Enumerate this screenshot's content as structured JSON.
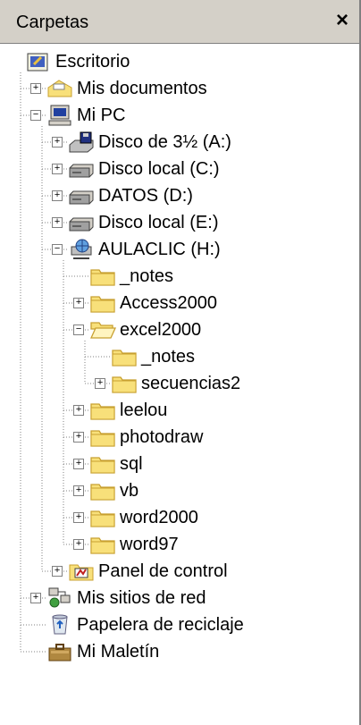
{
  "header": {
    "title": "Carpetas",
    "close_label": "×"
  },
  "tree": [
    {
      "label": "Escritorio",
      "icon": "desktop-icon",
      "level": 0,
      "expander": "none",
      "name": "tree-item-escritorio"
    },
    {
      "label": "Mis documentos",
      "icon": "my-documents-icon",
      "level": 1,
      "expander": "plus",
      "name": "tree-item-mis-documentos"
    },
    {
      "label": "Mi PC",
      "icon": "computer-icon",
      "level": 1,
      "expander": "minus",
      "name": "tree-item-mi-pc"
    },
    {
      "label": "Disco de 3½ (A:)",
      "icon": "floppy-drive-icon",
      "level": 2,
      "expander": "plus",
      "name": "tree-item-disco-a"
    },
    {
      "label": "Disco local (C:)",
      "icon": "hard-drive-icon",
      "level": 2,
      "expander": "plus",
      "name": "tree-item-disco-c"
    },
    {
      "label": "DATOS (D:)",
      "icon": "hard-drive-icon",
      "level": 2,
      "expander": "plus",
      "name": "tree-item-datos-d"
    },
    {
      "label": "Disco local (E:)",
      "icon": "hard-drive-icon",
      "level": 2,
      "expander": "plus",
      "name": "tree-item-disco-e"
    },
    {
      "label": "AULACLIC (H:)",
      "icon": "network-drive-icon",
      "level": 2,
      "expander": "minus",
      "name": "tree-item-aulaclic-h"
    },
    {
      "label": "_notes",
      "icon": "folder-icon",
      "level": 3,
      "expander": "none",
      "name": "tree-item-notes"
    },
    {
      "label": "Access2000",
      "icon": "folder-icon",
      "level": 3,
      "expander": "plus",
      "name": "tree-item-access2000"
    },
    {
      "label": "excel2000",
      "icon": "folder-open-icon",
      "level": 3,
      "expander": "minus",
      "name": "tree-item-excel2000"
    },
    {
      "label": "_notes",
      "icon": "folder-icon",
      "level": 4,
      "expander": "none",
      "name": "tree-item-excel-notes"
    },
    {
      "label": "secuencias2",
      "icon": "folder-icon",
      "level": 4,
      "expander": "plus",
      "name": "tree-item-secuencias2"
    },
    {
      "label": "leelou",
      "icon": "folder-icon",
      "level": 3,
      "expander": "plus",
      "name": "tree-item-leelou"
    },
    {
      "label": "photodraw",
      "icon": "folder-icon",
      "level": 3,
      "expander": "plus",
      "name": "tree-item-photodraw"
    },
    {
      "label": "sql",
      "icon": "folder-icon",
      "level": 3,
      "expander": "plus",
      "name": "tree-item-sql"
    },
    {
      "label": "vb",
      "icon": "folder-icon",
      "level": 3,
      "expander": "plus",
      "name": "tree-item-vb"
    },
    {
      "label": "word2000",
      "icon": "folder-icon",
      "level": 3,
      "expander": "plus",
      "name": "tree-item-word2000"
    },
    {
      "label": "word97",
      "icon": "folder-icon",
      "level": 3,
      "expander": "plus",
      "name": "tree-item-word97"
    },
    {
      "label": "Panel de control",
      "icon": "control-panel-icon",
      "level": 2,
      "expander": "plus",
      "name": "tree-item-panel-control"
    },
    {
      "label": "Mis sitios de red",
      "icon": "network-places-icon",
      "level": 1,
      "expander": "plus",
      "name": "tree-item-sitios-red"
    },
    {
      "label": "Papelera de reciclaje",
      "icon": "recycle-bin-icon",
      "level": 1,
      "expander": "none",
      "name": "tree-item-papelera"
    },
    {
      "label": "Mi Maletín",
      "icon": "briefcase-icon",
      "level": 1,
      "expander": "none",
      "name": "tree-item-maletin"
    }
  ],
  "colors": {
    "header_bg": "#d4d0c8",
    "folder_yellow": "#f8e07a",
    "folder_dark": "#c8a030",
    "tree_line": "#808080"
  }
}
